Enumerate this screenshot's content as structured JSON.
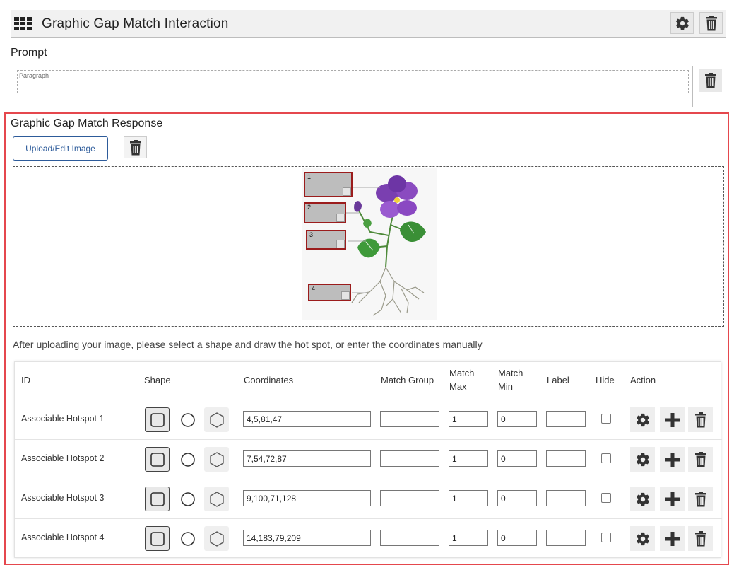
{
  "header": {
    "title": "Graphic Gap Match Interaction"
  },
  "prompt": {
    "label": "Prompt",
    "placeholder": "Paragraph"
  },
  "response": {
    "title": "Graphic Gap Match Response",
    "upload_label": "Upload/Edit Image",
    "hotspot_labels": [
      "1",
      "2",
      "3",
      "4"
    ],
    "instructions": "After uploading your image, please select a shape and draw the hot spot, or enter the coordinates manually"
  },
  "table": {
    "headers": {
      "id": "ID",
      "shape": "Shape",
      "coordinates": "Coordinates",
      "match_group": "Match Group",
      "match_max": "Match Max",
      "match_min": "Match Min",
      "label": "Label",
      "hide": "Hide",
      "action": "Action"
    },
    "rows": [
      {
        "id": "Associable Hotspot 1",
        "coordinates": "4,5,81,47",
        "match_group": "",
        "match_max": "1",
        "match_min": "0",
        "label": "",
        "hide": false
      },
      {
        "id": "Associable Hotspot 2",
        "coordinates": "7,54,72,87",
        "match_group": "",
        "match_max": "1",
        "match_min": "0",
        "label": "",
        "hide": false
      },
      {
        "id": "Associable Hotspot 3",
        "coordinates": "9,100,71,128",
        "match_group": "",
        "match_max": "1",
        "match_min": "0",
        "label": "",
        "hide": false
      },
      {
        "id": "Associable Hotspot 4",
        "coordinates": "14,183,79,209",
        "match_group": "",
        "match_max": "1",
        "match_min": "0",
        "label": "",
        "hide": false
      }
    ]
  },
  "icons": {
    "header_menu": "grid-icon",
    "settings": "gear-icon",
    "delete": "trash-icon",
    "add": "plus-icon",
    "shapes": [
      "rectangle-icon",
      "circle-icon",
      "hexagon-icon"
    ]
  },
  "colors": {
    "accent_border": "#e5474d",
    "upload_button": "#2d5b9a",
    "hotspot_border": "#9b1c1c"
  }
}
